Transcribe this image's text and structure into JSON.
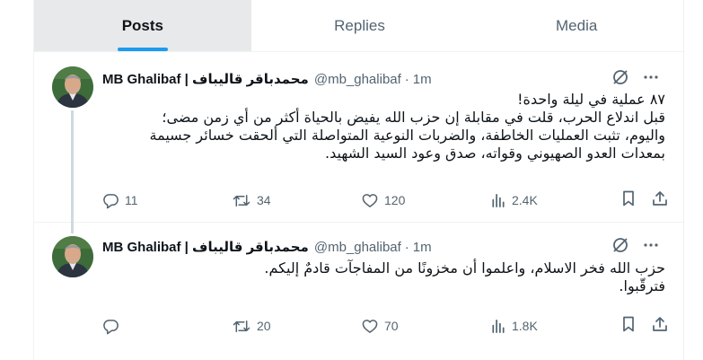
{
  "tabs": [
    {
      "label": "Posts",
      "active": true
    },
    {
      "label": "Replies",
      "active": false
    },
    {
      "label": "Media",
      "active": false
    }
  ],
  "tweets": [
    {
      "name": "MB Ghalibaf | محمدباقر قالیباف",
      "handle": "@mb_ghalibaf",
      "separator": "·",
      "time": "1m",
      "lines": [
        "٨٧ عملية في ليلة واحدة!",
        "قبل اندلاع الحرب، قلت في مقابلة إن حزب الله يفيض بالحياة أكثر من أي زمن مضى؛",
        "واليوم، تثبت العمليات الخاطفة، والضربات النوعية المتواصلة التي ألحقت خسائر جسيمة",
        "بمعدات العدو الصهيوني وقواته، صدق وعود السيد الشهيد."
      ],
      "replies": "11",
      "reposts": "34",
      "likes": "120",
      "views": "2.4K"
    },
    {
      "name": "MB Ghalibaf | محمدباقر قالیباف",
      "handle": "@mb_ghalibaf",
      "separator": "·",
      "time": "1m",
      "lines": [
        "حزب الله فخر الاسلام، واعلموا أن مخزونًا من المفاجآت قادمٌ إليكم.",
        "فترقّبوا."
      ],
      "replies": "",
      "reposts": "20",
      "likes": "70",
      "views": "1.8K"
    }
  ],
  "colors": {
    "accent": "#1d9bf0",
    "text": "#0f1419",
    "secondary": "#536471",
    "border": "#eff3f4",
    "active_tab_bg": "#e7e9ea"
  },
  "icons": [
    "grok-icon",
    "more-icon",
    "reply-icon",
    "repost-icon",
    "like-icon",
    "views-icon",
    "bookmark-icon",
    "share-icon"
  ]
}
